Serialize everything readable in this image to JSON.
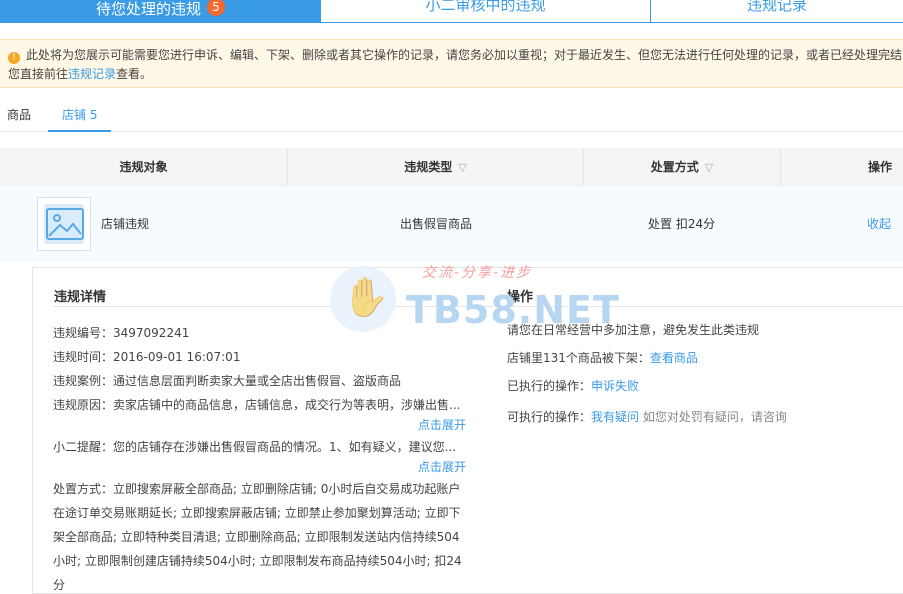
{
  "tabs": [
    {
      "label": "待您处理的违规",
      "badge": "5"
    },
    {
      "label": "小二审核中的违规"
    },
    {
      "label": "违规记录"
    }
  ],
  "notice": {
    "icon": "warning-icon",
    "text1": "此处将为您展示可能需要您进行申诉、编辑、下架、删除或者其它操作的记录，请您务必加以重视；对于最近发生、但您无法进行任何处理的记录，或者已经处理完结",
    "text2_pre": "您直接前往",
    "link": "违规记录",
    "text2_post": "查看。"
  },
  "subtabs": [
    {
      "label": "商品"
    },
    {
      "label": "店铺 5"
    }
  ],
  "table": {
    "headers": [
      "违规对象",
      "违规类型",
      "处置方式",
      "操作"
    ],
    "row": {
      "object": "店铺违规",
      "type": "出售假冒商品",
      "handling": "处置 扣24分",
      "action": "收起"
    }
  },
  "detail": {
    "title": "违规详情",
    "fields": [
      "违规编号：3497092241",
      "违规时间：2016-09-01 16:07:01",
      "违规案例：通过信息层面判断卖家大量或全店出售假冒、盗版商品",
      "违规原因：卖家店铺中的商品信息，店铺信息，成交行为等表明，涉嫌出售..."
    ],
    "expand1": "点击展开",
    "reminder": "小二提醒：您的店铺存在涉嫌出售假冒商品的情况。1、如有疑义，建议您...",
    "expand2": "点击展开",
    "handling_lines": [
      "处置方式：立即搜索屏蔽全部商品; 立即删除店铺; 0小时后自交易成功起账户",
      "在途订单交易账期延长; 立即搜索屏蔽店铺; 立即禁止参加聚划算活动; 立即下",
      "架全部商品; 立即特种类目清退; 立即删除商品; 立即限制发送站内信持续504",
      "小时; 立即限制创建店铺持续504小时; 立即限制发布商品持续504小时; 扣24",
      "分"
    ]
  },
  "ops": {
    "title": "操作",
    "line1": "请您在日常经营中多加注意，避免发生此类违规",
    "line2_pre": "店铺里131个商品被下架：",
    "line2_link": "查看商品",
    "line3_pre": "已执行的操作：",
    "line3_link": "申诉失败",
    "line4_pre": "可执行的操作：",
    "line4_link": "我有疑问",
    "line4_post": "如您对处罚有疑问，请咨询"
  },
  "watermark": {
    "slogan": "交流-分享-进步",
    "text": "TB58.NET"
  },
  "colors": {
    "accent": "#3a9be6",
    "badge": "#f56a2a",
    "notice_bg": "#fff8e6"
  }
}
